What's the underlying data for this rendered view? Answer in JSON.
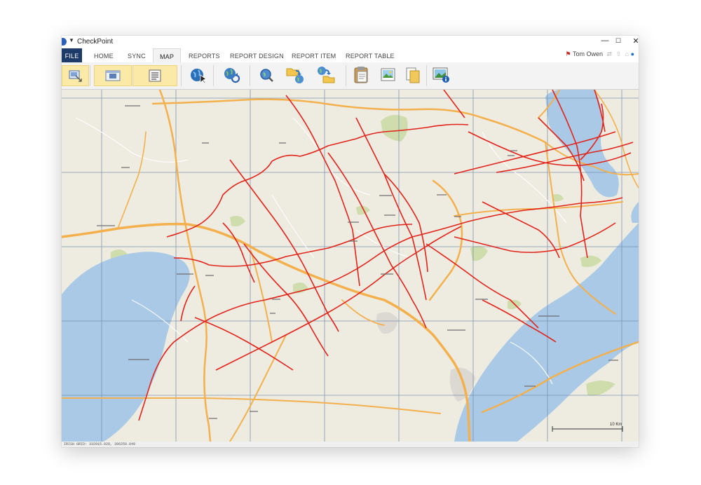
{
  "window": {
    "title": "CheckPoint",
    "controls": {
      "minimize": "—",
      "maximize": "☐",
      "close": "✕"
    }
  },
  "tabs": [
    {
      "label": "FILE"
    },
    {
      "label": "HOME"
    },
    {
      "label": "SYNC"
    },
    {
      "label": "MAP"
    },
    {
      "label": "REPORTS"
    },
    {
      "label": "REPORT DESIGN"
    },
    {
      "label": "REPORT ITEM"
    },
    {
      "label": "REPORT TABLE"
    }
  ],
  "active_tab": "MAP",
  "user": {
    "name": "Tom Owen"
  },
  "ribbon": {
    "buttons": [
      "map-select-tool-icon",
      "map-view-icon",
      "map-layers-icon",
      "globe-cursor-icon",
      "globe-refresh-icon",
      "globe-search-icon",
      "folder-globe-export-icon",
      "globe-folder-import-icon",
      "clipboard-icon",
      "image-icon",
      "copy-icon",
      "map-info-icon"
    ]
  },
  "map": {
    "scale_label": "10 Km",
    "colors": {
      "land": "#eeece1",
      "water": "#a9c9e7",
      "motorway": "#f3b04d",
      "route": "#e2231a",
      "grid": "#6f86a8",
      "park": "#cfdcab"
    }
  },
  "statusbar": {
    "text": "IRISH GRID: 332915.028, 396250.049"
  }
}
